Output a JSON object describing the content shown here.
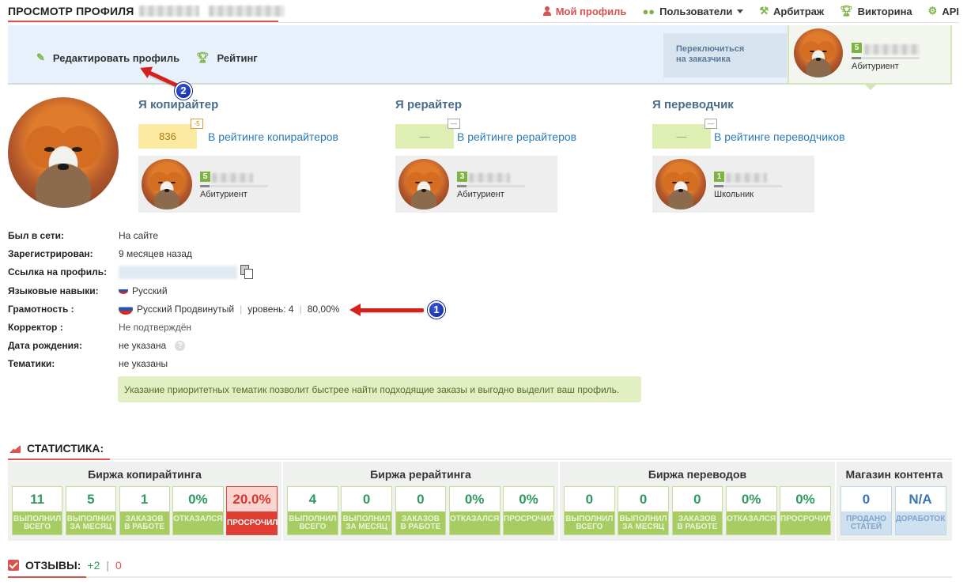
{
  "header": {
    "title": "ПРОСМОТР ПРОФИЛЯ",
    "nav": [
      {
        "label": "Мой профиль",
        "icon": "user-icon",
        "active": true
      },
      {
        "label": "Пользователи",
        "icon": "users-icon",
        "dropdown": true
      },
      {
        "label": "Арбитраж",
        "icon": "gavel-icon"
      },
      {
        "label": "Викторина",
        "icon": "trophy-icon"
      },
      {
        "label": "API",
        "icon": "gear-icon"
      }
    ]
  },
  "profile_bar": {
    "edit_label": "Редактировать профиль",
    "rating_label": "Рейтинг",
    "switch_line1": "Переключиться",
    "switch_line2": "на заказчика",
    "account_level": "5",
    "account_rank": "Абитуриент"
  },
  "specs": [
    {
      "title": "Я копирайтер",
      "score": "836",
      "score_change": "-5",
      "rank_link": "В рейтинге копирайтеров",
      "level": "5",
      "rank": "Абитуриент"
    },
    {
      "title": "Я рерайтер",
      "score": "—",
      "score_change": "—",
      "rank_link": "В рейтинге рерайтеров",
      "level": "3",
      "rank": "Абитуриент"
    },
    {
      "title": "Я переводчик",
      "score": "—",
      "score_change": "—",
      "rank_link": "В рейтинге переводчиков",
      "level": "1",
      "rank": "Школьник"
    }
  ],
  "info": {
    "online_label": "Был в сети:",
    "online_value": "На сайте",
    "registered_label": "Зарегистрирован:",
    "registered_value": "9 месяцев назад",
    "link_label": "Ссылка на профиль:",
    "lang_label": "Языковые навыки:",
    "lang_value": "Русский",
    "literacy_label": "Грамотность :",
    "literacy_lang": "Русский Продвинутый",
    "literacy_level": "уровень: 4",
    "literacy_pct": "80,00%",
    "corrector_label": "Корректор :",
    "corrector_value": "Не подтверждён",
    "birth_label": "Дата рождения:",
    "birth_value": "не указана",
    "topics_label": "Тематики:",
    "topics_value": "не указаны",
    "hint": "Указание приоритетных тематик позволит быстрее найти подходящие заказы и выгодно выделит ваш профиль."
  },
  "annotations": {
    "badge1": "1",
    "badge2": "2"
  },
  "stats": {
    "heading": "СТАТИСТИКА:",
    "blocks": [
      {
        "title": "Биржа копирайтинга",
        "cards": [
          {
            "value": "11",
            "label1": "выполнил",
            "label2": "всего"
          },
          {
            "value": "5",
            "label1": "выполнил",
            "label2": "за месяц"
          },
          {
            "value": "1",
            "label1": "заказов",
            "label2": "в работе"
          },
          {
            "value": "0%",
            "label1": "отказался",
            "label2": ""
          },
          {
            "value": "20.0%",
            "label1": "просрочил",
            "label2": "",
            "style": "red"
          }
        ]
      },
      {
        "title": "Биржа рерайтинга",
        "cards": [
          {
            "value": "4",
            "label1": "выполнил",
            "label2": "всего"
          },
          {
            "value": "0",
            "label1": "выполнил",
            "label2": "за месяц"
          },
          {
            "value": "0",
            "label1": "заказов",
            "label2": "в работе"
          },
          {
            "value": "0%",
            "label1": "отказался",
            "label2": ""
          },
          {
            "value": "0%",
            "label1": "просрочил",
            "label2": ""
          }
        ]
      },
      {
        "title": "Биржа переводов",
        "cards": [
          {
            "value": "0",
            "label1": "выполнил",
            "label2": "всего"
          },
          {
            "value": "0",
            "label1": "выполнил",
            "label2": "за месяц"
          },
          {
            "value": "0",
            "label1": "заказов",
            "label2": "в работе"
          },
          {
            "value": "0%",
            "label1": "отказался",
            "label2": ""
          },
          {
            "value": "0%",
            "label1": "просрочил",
            "label2": ""
          }
        ]
      },
      {
        "title": "Магазин контента",
        "cards": [
          {
            "value": "0",
            "label1": "продано",
            "label2": "статей",
            "style": "blue"
          },
          {
            "value": "N/A",
            "label1": "доработок",
            "label2": "",
            "style": "blue"
          }
        ]
      }
    ]
  },
  "reviews": {
    "heading": "ОТЗЫВЫ:",
    "positive": "+2",
    "sep": "|",
    "negative": "0"
  },
  "colors": {
    "accent": "#d9534f",
    "green": "#7cb342",
    "link": "#2a7ab8"
  }
}
